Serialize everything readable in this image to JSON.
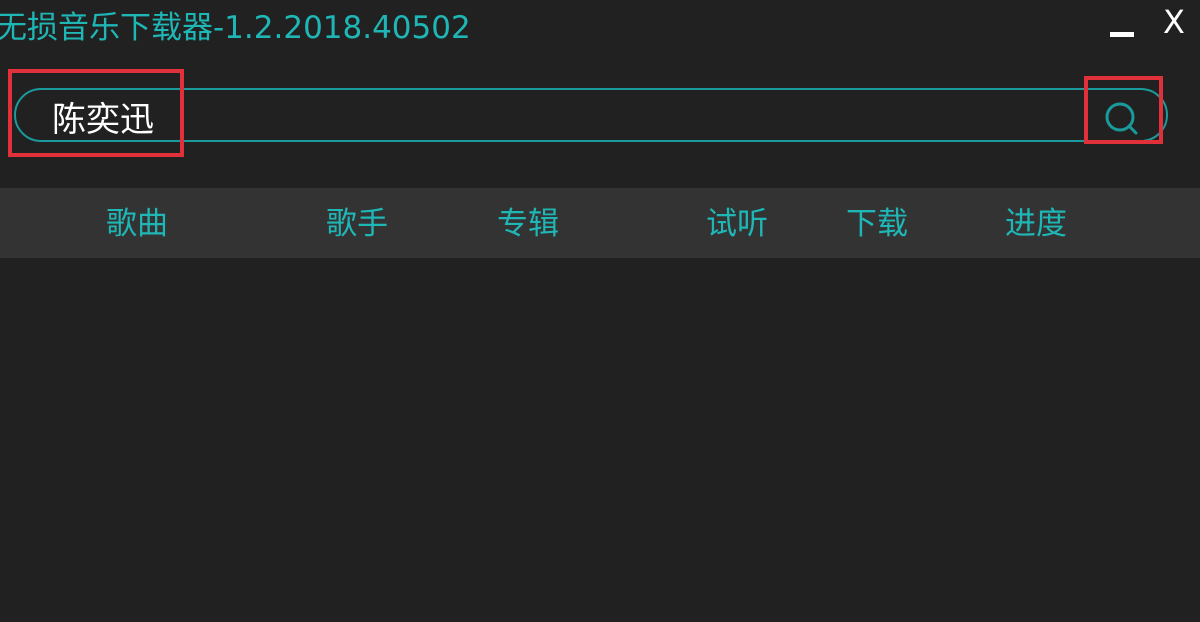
{
  "window": {
    "title": "无损音乐下载器-1.2.2018.40502",
    "close_label": "X"
  },
  "search": {
    "value": "陈奕迅",
    "icon": "search-icon"
  },
  "columns": [
    {
      "label": "歌曲"
    },
    {
      "label": "歌手"
    },
    {
      "label": "专辑"
    },
    {
      "label": "试听"
    },
    {
      "label": "下载"
    },
    {
      "label": "进度"
    }
  ],
  "colors": {
    "accent": "#1fb6b6",
    "background": "#212121",
    "header_bar": "#333333",
    "highlight": "#e0313a"
  }
}
